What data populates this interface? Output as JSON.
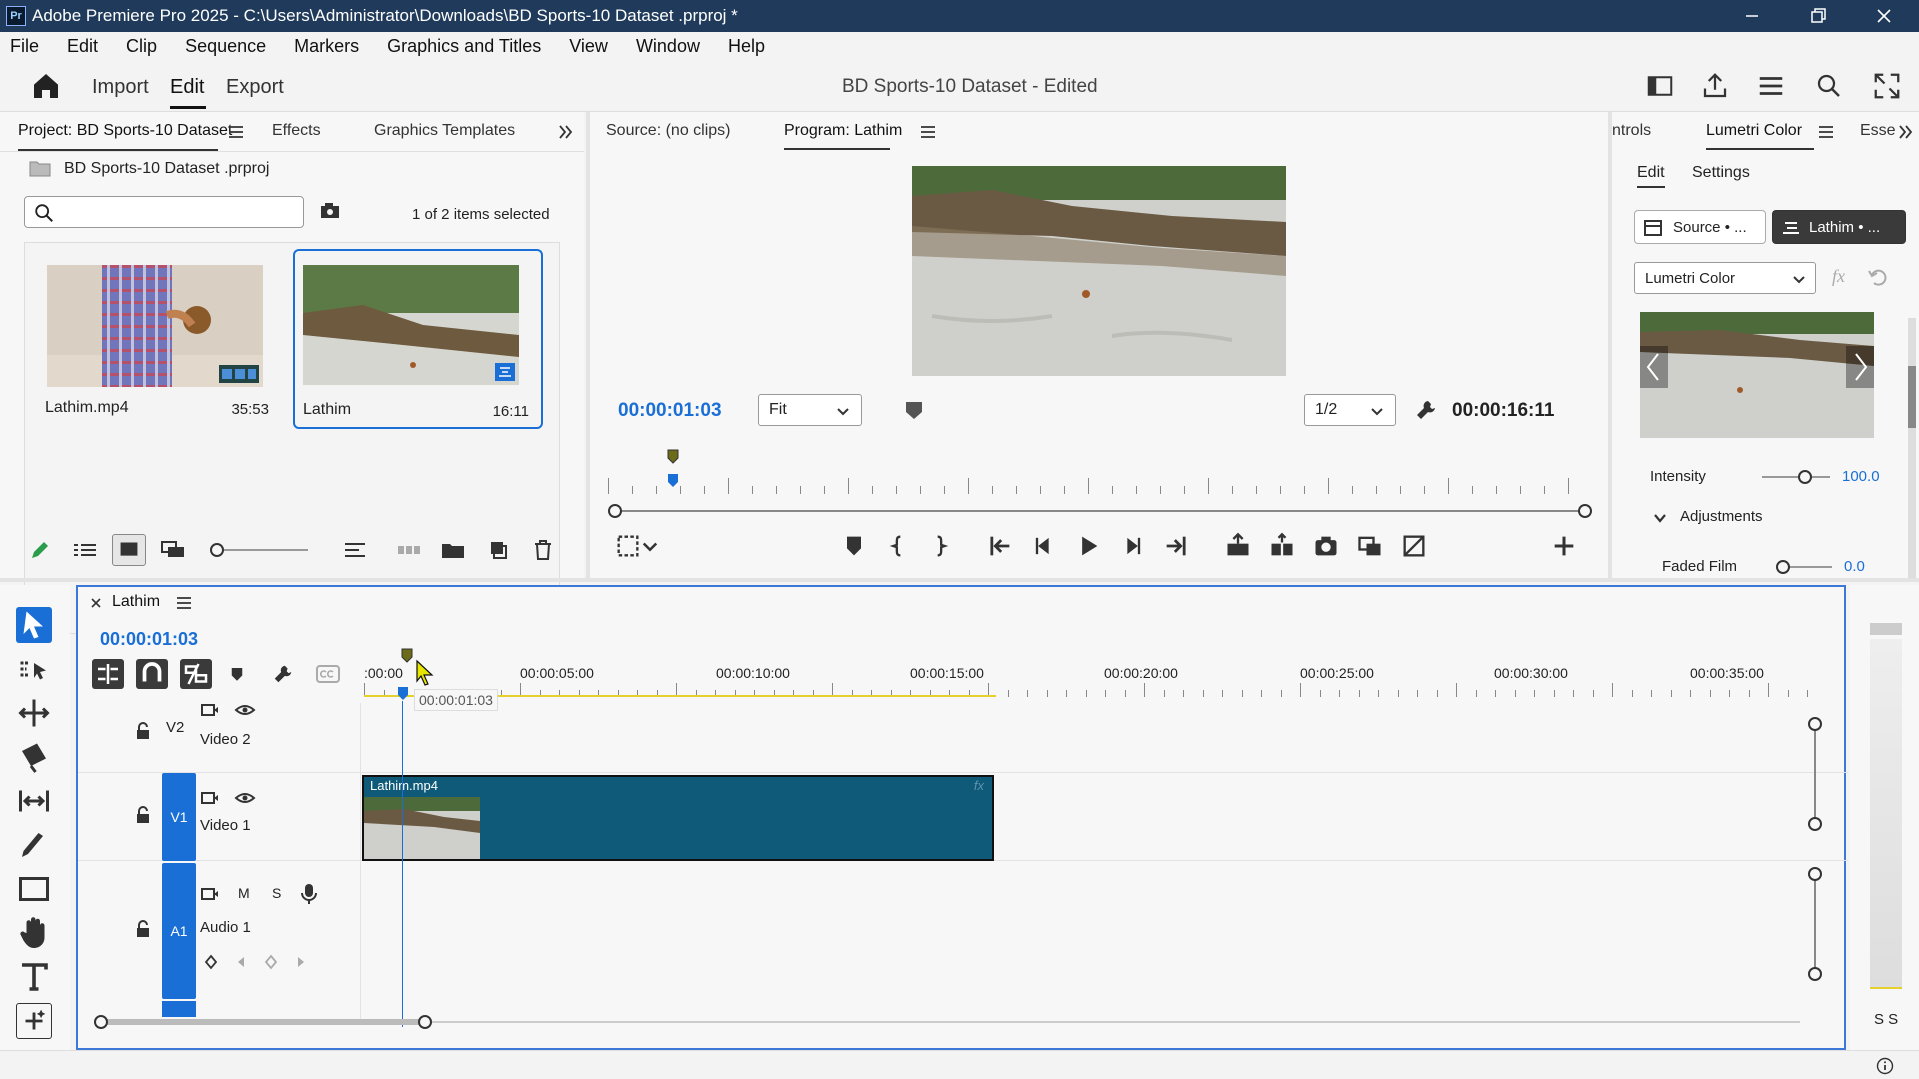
{
  "window": {
    "title": "Adobe Premiere Pro 2025 - C:\\Users\\Administrator\\Downloads\\BD Sports-10 Dataset .prproj *",
    "app_badge": "Pr"
  },
  "menu": [
    "File",
    "Edit",
    "Clip",
    "Sequence",
    "Markers",
    "Graphics and Titles",
    "View",
    "Window",
    "Help"
  ],
  "workspace": {
    "tabs": [
      "Import",
      "Edit",
      "Export"
    ],
    "active_tab": "Edit",
    "project_name": "BD Sports-10 Dataset",
    "project_status": "- Edited"
  },
  "project_panel": {
    "tabs": [
      "Project: BD Sports-10 Dataset",
      "Effects",
      "Graphics Templates"
    ],
    "file": "BD Sports-10 Dataset .prproj",
    "search_placeholder": "",
    "selection_info": "1 of 2 items selected",
    "items": [
      {
        "name": "Lathim.mp4",
        "duration": "35:53",
        "selected": false
      },
      {
        "name": "Lathim",
        "duration": "16:11",
        "selected": true
      }
    ]
  },
  "monitor": {
    "source_tab": "Source: (no clips)",
    "program_tab": "Program: Lathim",
    "current_timecode": "00:00:01:03",
    "fit": "Fit",
    "resolution": "1/2",
    "duration": "00:00:16:11",
    "playhead_progress": 0.066
  },
  "lumetri": {
    "tabs": [
      "ntrols",
      "Lumetri Color",
      "Esse"
    ],
    "subtabs": [
      "Edit",
      "Settings"
    ],
    "source_btn": "Source • ...",
    "clip_btn": "Lathim • ...",
    "effect": "Lumetri Color",
    "fx_label": "fx",
    "intensity_label": "Intensity",
    "intensity_value": "100.0",
    "adjustments_label": "Adjustments",
    "faded_film_label": "Faded Film",
    "faded_film_value": "0.0"
  },
  "timeline": {
    "sequence_name": "Lathim",
    "close": "×",
    "timecode": "00:00:01:03",
    "ruler_labels": [
      ":00:00",
      "00:00:05:00",
      "00:00:10:00",
      "00:00:15:00",
      "00:00:20:00",
      "00:00:25:00",
      "00:00:30:00",
      "00:00:35:00"
    ],
    "hover_timecode": "00:00:01:03",
    "tracks": {
      "v2": {
        "id": "V2",
        "name": "Video 2"
      },
      "v1": {
        "id": "V1",
        "name": "Video 1"
      },
      "a1": {
        "id": "A1",
        "name": "Audio 1",
        "m": "M",
        "s": "S"
      }
    },
    "clip": {
      "name": "Lathim.mp4",
      "fx": "fx"
    }
  },
  "audio_meter": {
    "labels": "S S"
  },
  "colors": {
    "accent": "#1a6fd6",
    "titlebar": "#1f3a5a",
    "clip": "#0e5a78"
  }
}
